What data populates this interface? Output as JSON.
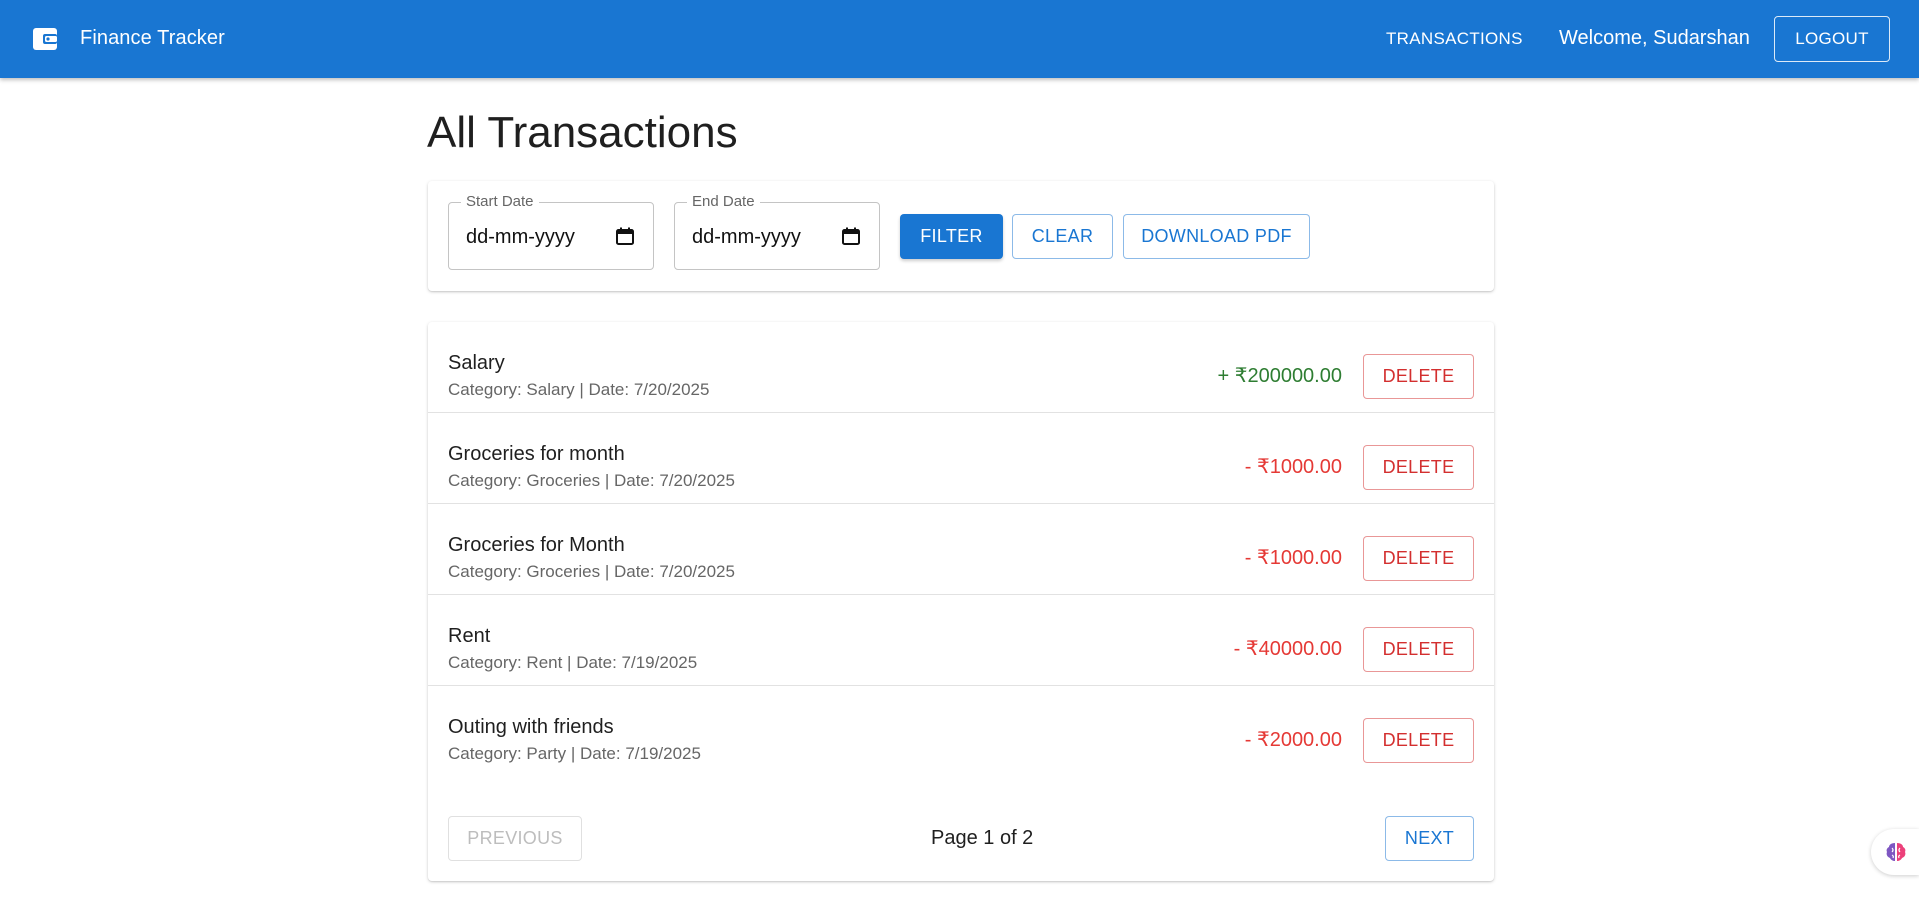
{
  "app": {
    "title": "Finance Tracker",
    "nav_transactions": "TRANSACTIONS",
    "welcome": "Welcome, Sudarshan",
    "logout_label": "LOGOUT",
    "brand_color": "#1976d2"
  },
  "page": {
    "title": "All Transactions"
  },
  "filter": {
    "start_label": "Start Date",
    "start_value": "dd-mm-yyyy",
    "end_label": "End Date",
    "end_value": "dd-mm-yyyy",
    "filter_label": "FILTER",
    "clear_label": "CLEAR",
    "download_label": "DOWNLOAD PDF"
  },
  "transactions": [
    {
      "description": "Salary",
      "meta": "Category: Salary | Date: 7/20/2025",
      "amount": "+ ₹200000.00",
      "type": "income",
      "delete_label": "DELETE"
    },
    {
      "description": "Groceries for month",
      "meta": "Category: Groceries | Date: 7/20/2025",
      "amount": "- ₹1000.00",
      "type": "expense",
      "delete_label": "DELETE"
    },
    {
      "description": "Groceries for Month",
      "meta": "Category: Groceries | Date: 7/20/2025",
      "amount": "- ₹1000.00",
      "type": "expense",
      "delete_label": "DELETE"
    },
    {
      "description": "Rent",
      "meta": "Category: Rent | Date: 7/19/2025",
      "amount": "- ₹40000.00",
      "type": "expense",
      "delete_label": "DELETE"
    },
    {
      "description": "Outing with friends",
      "meta": "Category: Party | Date: 7/19/2025",
      "amount": "- ₹2000.00",
      "type": "expense",
      "delete_label": "DELETE"
    }
  ],
  "colors": {
    "income": "#2e7d32",
    "expense": "#e53935"
  },
  "pagination": {
    "previous_label": "PREVIOUS",
    "page_text": "Page 1 of 2",
    "next_label": "NEXT"
  },
  "icons": {
    "brand": "wallet-icon",
    "calendar": "calendar-icon",
    "assistant": "brain-icon"
  }
}
